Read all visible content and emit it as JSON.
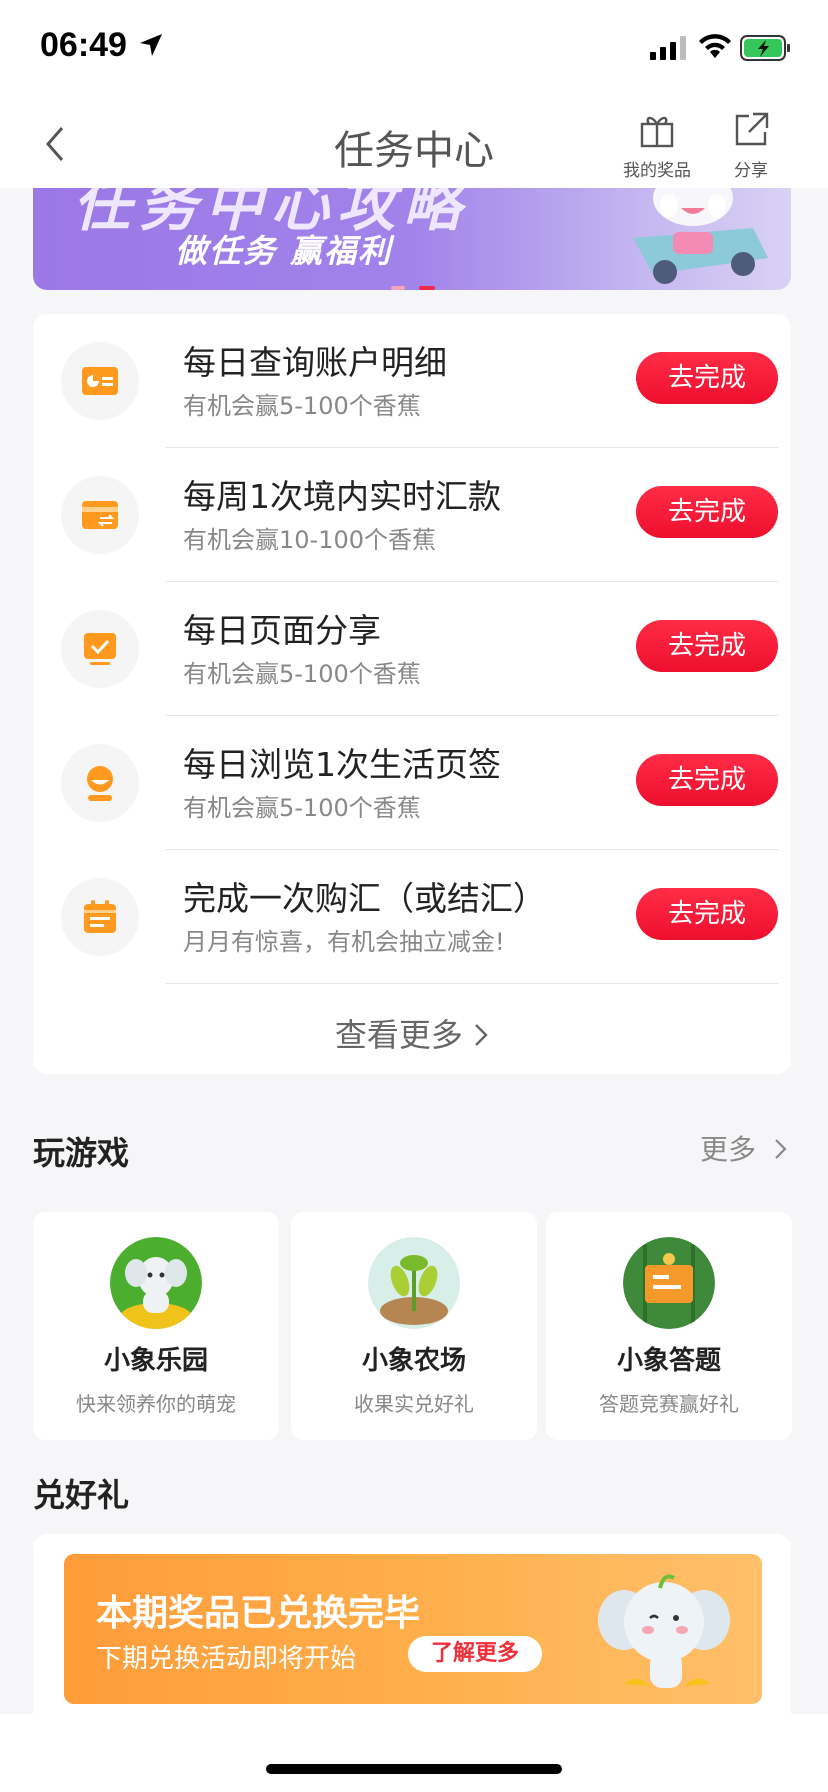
{
  "status": {
    "time": "06:49"
  },
  "nav": {
    "title": "任务中心",
    "prize_label": "我的奖品",
    "share_label": "分享"
  },
  "banner": {
    "headline": "任务中心攻略",
    "subtitle": "做任务 赢福利"
  },
  "tasks": [
    {
      "name": "每日查询账户明细",
      "desc": "有机会赢5-100个香蕉",
      "button": "去完成",
      "icon": "chart-card-icon"
    },
    {
      "name": "每周1次境内实时汇款",
      "desc": "有机会赢10-100个香蕉",
      "button": "去完成",
      "icon": "transfer-card-icon"
    },
    {
      "name": "每日页面分享",
      "desc": "有机会赢5-100个香蕉",
      "button": "去完成",
      "icon": "checked-screen-icon"
    },
    {
      "name": "每日浏览1次生活页签",
      "desc": "有机会赢5-100个香蕉",
      "button": "去完成",
      "icon": "person-icon"
    },
    {
      "name": "完成一次购汇（或结汇）",
      "desc": "月月有惊喜，有机会抽立减金!",
      "button": "去完成",
      "icon": "calendar-icon"
    }
  ],
  "tasks_more": "查看更多",
  "games": {
    "title": "玩游戏",
    "more": "更多",
    "items": [
      {
        "name": "小象乐园",
        "desc": "快来领养你的萌宠"
      },
      {
        "name": "小象农场",
        "desc": "收果实兑好礼"
      },
      {
        "name": "小象答题",
        "desc": "答题竞赛赢好礼"
      }
    ]
  },
  "gifts": {
    "title": "兑好礼",
    "headline": "本期奖品已兑换完毕",
    "subline": "下期兑换活动即将开始",
    "button": "了解更多"
  },
  "colors": {
    "accent_red": "#ee0f2e",
    "task_icon_orange": "#ff9a1f",
    "gift_orange": "#ffae4a"
  }
}
